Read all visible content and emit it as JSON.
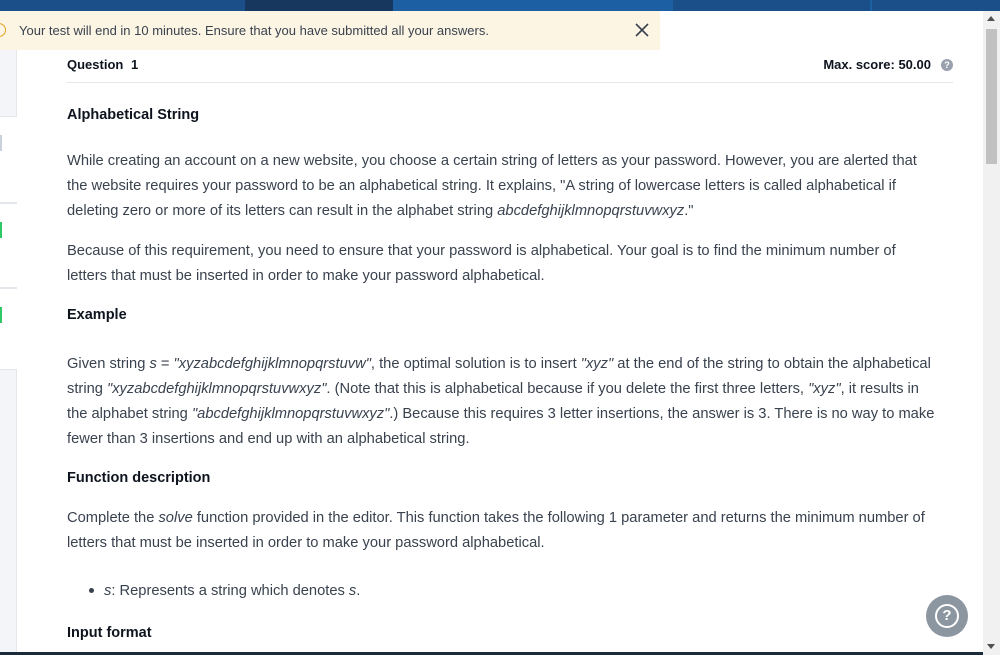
{
  "notification": {
    "message": "Your test will end in 10 minutes. Ensure that you have submitted all your answers."
  },
  "question": {
    "number_label": "Question",
    "number": "1",
    "max_score": "Max. score: 50.00",
    "title": "Alphabetical String"
  },
  "body": {
    "intro_p1_a": "While creating an account on a new website, you choose a certain string of letters as your password. However, you are alerted that the website requires your password to be an alphabetical string. It explains, \"A string of lowercase letters is called alphabetical if deleting zero or more of its letters can result in the alphabet string ",
    "intro_p1_em": "abcdefghijklmnopqrstuvwxyz",
    "intro_p1_b": ".\"",
    "intro_p2": "Because of this requirement, you need to ensure that your password is alphabetical. Your goal is to find the minimum number of letters that must be inserted in order to make your password alphabetical.",
    "example_heading": "Example",
    "example_s1": "Given string ",
    "example_var": "s",
    "example_s2": " = ",
    "example_str": "\"xyzabcdefghijklmnopqrstuvw\"",
    "example_s3": ", the optimal solution is to insert ",
    "example_ins": "\"xyz\"",
    "example_s4": " at the end of the string to obtain the alphabetical string ",
    "example_res": "\"xyzabcdefghijklmnopqrstuvwxyz\"",
    "example_s5": ". (Note that this is alphabetical because if you delete the first three letters, ",
    "example_del": "\"xyz\"",
    "example_s6": ", it results in the alphabet string ",
    "example_alpha": "\"abcdefghijklmnopqrstuvwxyz\"",
    "example_s7": ".) Because this requires 3 letter insertions, the answer is 3. There is no way to make fewer than 3 insertions and end up with an alphabetical string.",
    "function_heading": "Function description",
    "function_s1": "Complete the ",
    "function_name": "solve",
    "function_s2": " function provided in the editor. This function takes the following 1 parameter and returns the minimum number of letters that must be inserted in order to make your password alphabetical.",
    "param_var": "s",
    "param_desc": ": Represents a string which denotes ",
    "param_var2": "s",
    "param_end": ".",
    "input_heading": "Input format"
  },
  "colors": {
    "notice_bg": "#fdf5e4",
    "warn": "#e4a321",
    "nav": "#1d5fa3",
    "help_fab": "#8c96a0"
  },
  "icons": {
    "warning": "warning-icon",
    "close": "close-icon",
    "help": "help-circle-icon",
    "question_help": "question-circle-icon"
  }
}
